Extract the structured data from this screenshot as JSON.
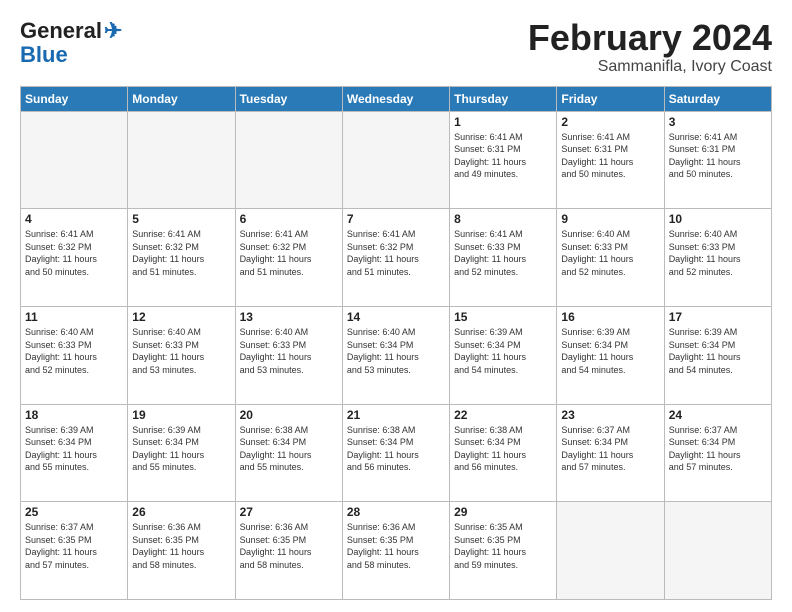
{
  "header": {
    "logo_line1": "General",
    "logo_line2": "Blue",
    "month": "February 2024",
    "location": "Sammanifla, Ivory Coast"
  },
  "weekdays": [
    "Sunday",
    "Monday",
    "Tuesday",
    "Wednesday",
    "Thursday",
    "Friday",
    "Saturday"
  ],
  "weeks": [
    [
      {
        "day": "",
        "info": ""
      },
      {
        "day": "",
        "info": ""
      },
      {
        "day": "",
        "info": ""
      },
      {
        "day": "",
        "info": ""
      },
      {
        "day": "1",
        "info": "Sunrise: 6:41 AM\nSunset: 6:31 PM\nDaylight: 11 hours\nand 49 minutes."
      },
      {
        "day": "2",
        "info": "Sunrise: 6:41 AM\nSunset: 6:31 PM\nDaylight: 11 hours\nand 50 minutes."
      },
      {
        "day": "3",
        "info": "Sunrise: 6:41 AM\nSunset: 6:31 PM\nDaylight: 11 hours\nand 50 minutes."
      }
    ],
    [
      {
        "day": "4",
        "info": "Sunrise: 6:41 AM\nSunset: 6:32 PM\nDaylight: 11 hours\nand 50 minutes."
      },
      {
        "day": "5",
        "info": "Sunrise: 6:41 AM\nSunset: 6:32 PM\nDaylight: 11 hours\nand 51 minutes."
      },
      {
        "day": "6",
        "info": "Sunrise: 6:41 AM\nSunset: 6:32 PM\nDaylight: 11 hours\nand 51 minutes."
      },
      {
        "day": "7",
        "info": "Sunrise: 6:41 AM\nSunset: 6:32 PM\nDaylight: 11 hours\nand 51 minutes."
      },
      {
        "day": "8",
        "info": "Sunrise: 6:41 AM\nSunset: 6:33 PM\nDaylight: 11 hours\nand 52 minutes."
      },
      {
        "day": "9",
        "info": "Sunrise: 6:40 AM\nSunset: 6:33 PM\nDaylight: 11 hours\nand 52 minutes."
      },
      {
        "day": "10",
        "info": "Sunrise: 6:40 AM\nSunset: 6:33 PM\nDaylight: 11 hours\nand 52 minutes."
      }
    ],
    [
      {
        "day": "11",
        "info": "Sunrise: 6:40 AM\nSunset: 6:33 PM\nDaylight: 11 hours\nand 52 minutes."
      },
      {
        "day": "12",
        "info": "Sunrise: 6:40 AM\nSunset: 6:33 PM\nDaylight: 11 hours\nand 53 minutes."
      },
      {
        "day": "13",
        "info": "Sunrise: 6:40 AM\nSunset: 6:33 PM\nDaylight: 11 hours\nand 53 minutes."
      },
      {
        "day": "14",
        "info": "Sunrise: 6:40 AM\nSunset: 6:34 PM\nDaylight: 11 hours\nand 53 minutes."
      },
      {
        "day": "15",
        "info": "Sunrise: 6:39 AM\nSunset: 6:34 PM\nDaylight: 11 hours\nand 54 minutes."
      },
      {
        "day": "16",
        "info": "Sunrise: 6:39 AM\nSunset: 6:34 PM\nDaylight: 11 hours\nand 54 minutes."
      },
      {
        "day": "17",
        "info": "Sunrise: 6:39 AM\nSunset: 6:34 PM\nDaylight: 11 hours\nand 54 minutes."
      }
    ],
    [
      {
        "day": "18",
        "info": "Sunrise: 6:39 AM\nSunset: 6:34 PM\nDaylight: 11 hours\nand 55 minutes."
      },
      {
        "day": "19",
        "info": "Sunrise: 6:39 AM\nSunset: 6:34 PM\nDaylight: 11 hours\nand 55 minutes."
      },
      {
        "day": "20",
        "info": "Sunrise: 6:38 AM\nSunset: 6:34 PM\nDaylight: 11 hours\nand 55 minutes."
      },
      {
        "day": "21",
        "info": "Sunrise: 6:38 AM\nSunset: 6:34 PM\nDaylight: 11 hours\nand 56 minutes."
      },
      {
        "day": "22",
        "info": "Sunrise: 6:38 AM\nSunset: 6:34 PM\nDaylight: 11 hours\nand 56 minutes."
      },
      {
        "day": "23",
        "info": "Sunrise: 6:37 AM\nSunset: 6:34 PM\nDaylight: 11 hours\nand 57 minutes."
      },
      {
        "day": "24",
        "info": "Sunrise: 6:37 AM\nSunset: 6:34 PM\nDaylight: 11 hours\nand 57 minutes."
      }
    ],
    [
      {
        "day": "25",
        "info": "Sunrise: 6:37 AM\nSunset: 6:35 PM\nDaylight: 11 hours\nand 57 minutes."
      },
      {
        "day": "26",
        "info": "Sunrise: 6:36 AM\nSunset: 6:35 PM\nDaylight: 11 hours\nand 58 minutes."
      },
      {
        "day": "27",
        "info": "Sunrise: 6:36 AM\nSunset: 6:35 PM\nDaylight: 11 hours\nand 58 minutes."
      },
      {
        "day": "28",
        "info": "Sunrise: 6:36 AM\nSunset: 6:35 PM\nDaylight: 11 hours\nand 58 minutes."
      },
      {
        "day": "29",
        "info": "Sunrise: 6:35 AM\nSunset: 6:35 PM\nDaylight: 11 hours\nand 59 minutes."
      },
      {
        "day": "",
        "info": ""
      },
      {
        "day": "",
        "info": ""
      }
    ]
  ]
}
